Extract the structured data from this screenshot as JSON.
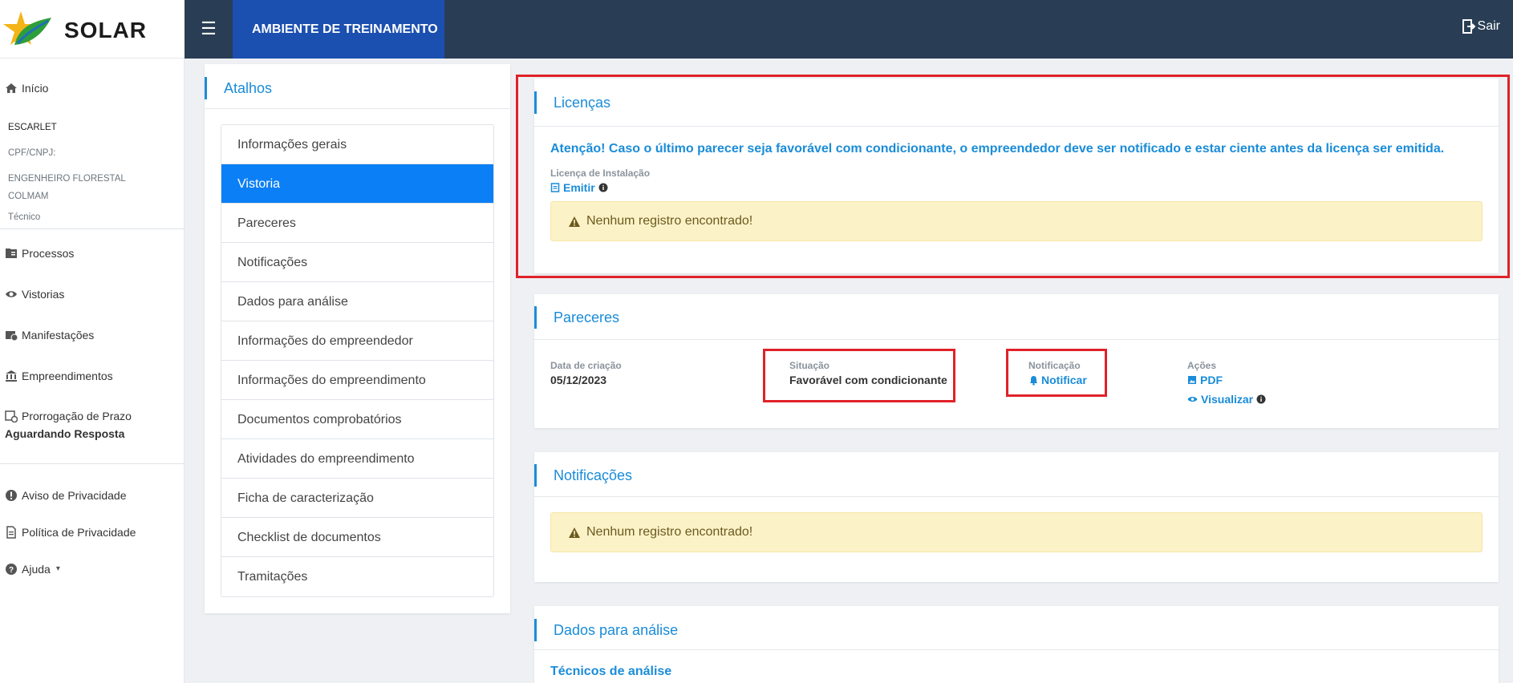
{
  "header": {
    "logo_text": "SOLAR",
    "env_badge": "AMBIENTE DE TREINAMENTO",
    "logout_label": "Sair"
  },
  "sidebar": {
    "home": "Início",
    "user_name": "ESCARLET",
    "doc_label": "CPF/CNPJ:",
    "role_line1": "ENGENHEIRO FLORESTAL",
    "role_line2": "COLMAM",
    "role_type": "Técnico",
    "nav": {
      "processos": "Processos",
      "vistorias": "Vistorias",
      "manifestacoes": "Manifestações",
      "empreendimentos": "Empreendimentos",
      "prorrogacao_1": "Prorrogação de Prazo",
      "prorrogacao_2": "Aguardando Resposta"
    },
    "footer": {
      "aviso": "Aviso de Privacidade",
      "politica": "Política de Privacidade",
      "ajuda": "Ajuda"
    }
  },
  "shortcuts": {
    "title": "Atalhos",
    "items": [
      "Informações gerais",
      "Vistoria",
      "Pareceres",
      "Notificações",
      "Dados para análise",
      "Informações do empreendedor",
      "Informações do empreendimento",
      "Documentos comprobatórios",
      "Atividades do empreendimento",
      "Ficha de caracterização",
      "Checklist de documentos",
      "Tramitações"
    ],
    "active_index": 1
  },
  "licencas": {
    "title": "Licenças",
    "warning": "Atenção! Caso o último parecer seja favorável com condicionante, o empreendedor deve ser notificado e estar ciente antes da licença ser emitida.",
    "licence_type": "Licença de Instalação",
    "emit_label": "Emitir",
    "empty_message": "Nenhum registro encontrado!"
  },
  "pareceres": {
    "title": "Pareceres",
    "created_label": "Data de criação",
    "created_value": "05/12/2023",
    "status_label": "Situação",
    "status_value": "Favorável com condicionante",
    "notification_label": "Notificação",
    "notify_action": "Notificar",
    "actions_label": "Ações",
    "pdf_action": "PDF",
    "view_action": "Visualizar"
  },
  "notificacoes": {
    "title": "Notificações",
    "empty_message": "Nenhum registro encontrado!"
  },
  "dados": {
    "title": "Dados para análise",
    "subtitle": "Técnicos de análise"
  },
  "colors": {
    "topbar": "#293d54",
    "env_badge": "#1b4fb0",
    "accent": "#1a8cd8",
    "active_item": "#0b7ff5",
    "highlight_box": "#e02228",
    "warning_bg": "#fcf2c8"
  }
}
